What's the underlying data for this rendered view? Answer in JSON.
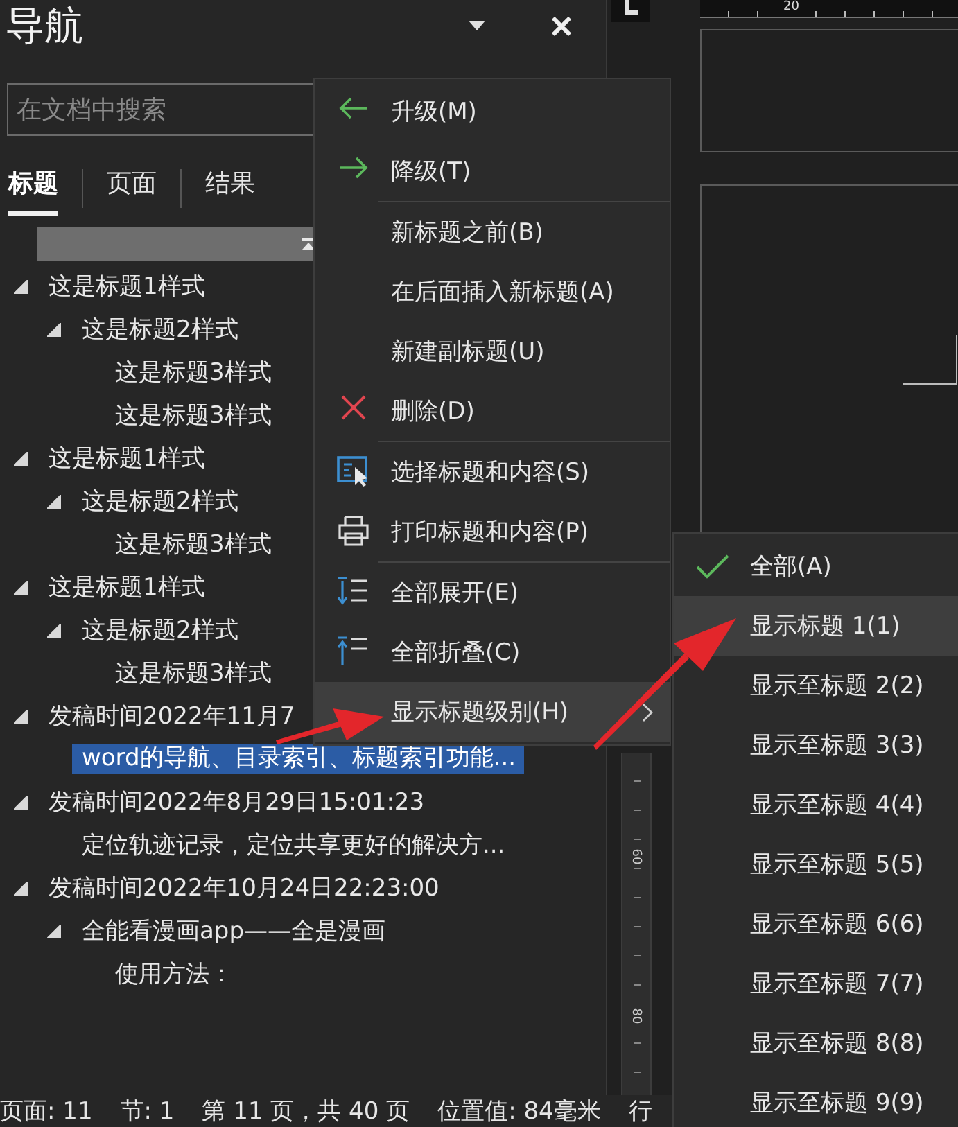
{
  "nav_pane": {
    "title": "导航",
    "search": {
      "placeholder": "在文档中搜索"
    },
    "tabs": [
      {
        "label": "标题",
        "selected": true
      },
      {
        "label": "页面",
        "selected": false
      },
      {
        "label": "结果",
        "selected": false
      }
    ],
    "headings": [
      {
        "text": "这是标题1样式",
        "expanded": true,
        "selected": false,
        "children": [
          {
            "text": "这是标题2样式",
            "expanded": true,
            "selected": false,
            "children": [
              {
                "text": "这是标题3样式",
                "selected": false
              },
              {
                "text": "这是标题3样式",
                "selected": false
              }
            ]
          }
        ]
      },
      {
        "text": "这是标题1样式",
        "expanded": true,
        "selected": false,
        "children": [
          {
            "text": "这是标题2样式",
            "expanded": true,
            "selected": false,
            "children": [
              {
                "text": "这是标题3样式",
                "selected": false
              }
            ]
          }
        ]
      },
      {
        "text": "这是标题1样式",
        "expanded": true,
        "selected": false,
        "children": [
          {
            "text": "这是标题2样式",
            "expanded": true,
            "selected": false,
            "children": [
              {
                "text": "这是标题3样式",
                "selected": false
              }
            ]
          }
        ]
      },
      {
        "text": "发稿时间2022年11月7",
        "expanded": true,
        "selected": false,
        "children": [
          {
            "text": "word的导航、目录索引、标题索引功能...",
            "selected": true
          }
        ]
      },
      {
        "text": "发稿时间2022年8月29日15:01:23",
        "expanded": true,
        "selected": false,
        "children": [
          {
            "text": "定位轨迹记录，定位共享更好的解决方...",
            "selected": false
          }
        ]
      },
      {
        "text": "发稿时间2022年10月24日22:23:00",
        "expanded": true,
        "selected": false,
        "children": [
          {
            "text": "全能看漫画app——全是漫画",
            "expanded": true,
            "selected": false,
            "children": [
              {
                "text": "使用方法：",
                "selected": false
              }
            ]
          }
        ]
      }
    ]
  },
  "rulers": {
    "horizontal_labels": [
      "20"
    ],
    "vertical_labels": [
      "60",
      "80"
    ]
  },
  "context_menu": {
    "items": [
      {
        "label": "升级(M)",
        "separator_before": false,
        "highlighted": false,
        "has_submenu": false
      },
      {
        "label": "降级(T)",
        "separator_before": false,
        "highlighted": false,
        "has_submenu": false
      },
      {
        "label": "新标题之前(B)",
        "separator_before": true,
        "highlighted": false,
        "has_submenu": false
      },
      {
        "label": "在后面插入新标题(A)",
        "separator_before": false,
        "highlighted": false,
        "has_submenu": false
      },
      {
        "label": "新建副标题(U)",
        "separator_before": false,
        "highlighted": false,
        "has_submenu": false
      },
      {
        "label": "删除(D)",
        "separator_before": false,
        "highlighted": false,
        "has_submenu": false
      },
      {
        "label": "选择标题和内容(S)",
        "separator_before": true,
        "highlighted": false,
        "has_submenu": false
      },
      {
        "label": "打印标题和内容(P)",
        "separator_before": false,
        "highlighted": false,
        "has_submenu": false
      },
      {
        "label": "全部展开(E)",
        "separator_before": true,
        "highlighted": false,
        "has_submenu": false
      },
      {
        "label": "全部折叠(C)",
        "separator_before": false,
        "highlighted": false,
        "has_submenu": false
      },
      {
        "label": "显示标题级别(H)",
        "separator_before": false,
        "highlighted": true,
        "has_submenu": true
      }
    ]
  },
  "submenu": {
    "items": [
      {
        "label": "全部(A)",
        "checked": true,
        "highlighted": false
      },
      {
        "label": "显示标题 1(1)",
        "checked": false,
        "highlighted": true
      },
      {
        "label": "显示至标题 2(2)",
        "checked": false,
        "highlighted": false
      },
      {
        "label": "显示至标题 3(3)",
        "checked": false,
        "highlighted": false
      },
      {
        "label": "显示至标题 4(4)",
        "checked": false,
        "highlighted": false
      },
      {
        "label": "显示至标题 5(5)",
        "checked": false,
        "highlighted": false
      },
      {
        "label": "显示至标题 6(6)",
        "checked": false,
        "highlighted": false
      },
      {
        "label": "显示至标题 7(7)",
        "checked": false,
        "highlighted": false
      },
      {
        "label": "显示至标题 8(8)",
        "checked": false,
        "highlighted": false
      },
      {
        "label": "显示至标题 9(9)",
        "checked": false,
        "highlighted": false
      }
    ]
  },
  "status_bar": {
    "items": [
      "页面: 11",
      "节: 1",
      "第 11 页，共 40 页",
      "位置值: 84毫米",
      "行"
    ]
  }
}
